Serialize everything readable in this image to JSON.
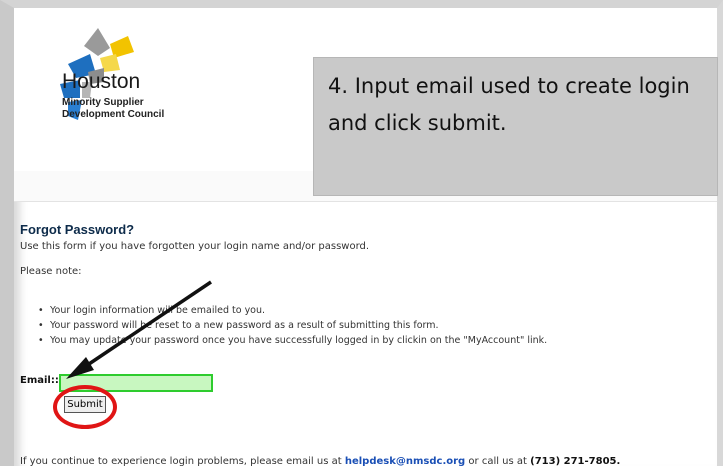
{
  "logo": {
    "word": "Houston",
    "sub_line1": "Minority Supplier",
    "sub_line2": "Development Council"
  },
  "callout": {
    "line1": "4. Input email used to create login",
    "line2": "and click submit."
  },
  "form": {
    "title": "Forgot Password?",
    "intro": "Use this form if you have forgotten your login name and/or password.",
    "note_label": "Please note:",
    "bullets": [
      "Your login information will be emailed to you.",
      "Your password will be reset to a new password as a result of submitting this form.",
      "You may update your password once you have successfully logged in by clickin on the \"MyAccount\" link."
    ],
    "email_label": "Email::",
    "email_value": "",
    "submit_label": "Submit"
  },
  "footer": {
    "prefix": "If you continue to experience login problems, please email us at",
    "email": "helpdesk@nmsdc.org",
    "middle": "or call us at",
    "phone": "(713) 271-7805."
  },
  "colors": {
    "input_border": "#2ecc2e",
    "input_fill": "#c8f7c0",
    "annotation_red": "#e01515",
    "callout_bg": "#c9c9c9"
  }
}
